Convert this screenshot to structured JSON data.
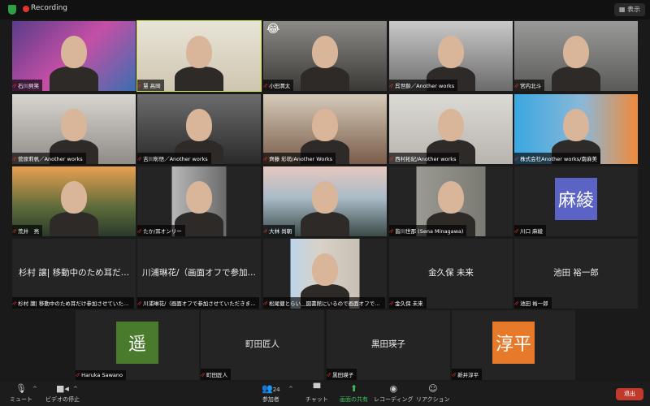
{
  "topbar": {
    "recording_label": "Recording",
    "view_label": "▦ 表示"
  },
  "tiles": [
    {
      "name": "石川貝笑",
      "type": "video",
      "bg": "linear-gradient(135deg,#5b3c8a,#c44fa6 50%,#3a6fb0)"
    },
    {
      "name": "慧 高岡",
      "type": "video",
      "bg": "linear-gradient(180deg,#e8e4d8,#cfc6b0)",
      "active": true
    },
    {
      "name": "小田潤太",
      "type": "video",
      "bg": "linear-gradient(180deg,#8b8a86,#3a3936)",
      "emoji": "😂"
    },
    {
      "name": "呉世齢／Another works",
      "type": "video",
      "bg": "linear-gradient(180deg,#c9c9c9,#6b6b6b)"
    },
    {
      "name": "宮内北斗",
      "type": "video",
      "bg": "linear-gradient(180deg,#9a9a98,#5a5a58)"
    },
    {
      "name": "菅原莉帆／Another works",
      "type": "video",
      "bg": "linear-gradient(180deg,#d9d6d2,#8f8c88)"
    },
    {
      "name": "吉川彰悟／Another works",
      "type": "video",
      "bg": "linear-gradient(180deg,#6c6c6c,#2a2a2a)"
    },
    {
      "name": "齊藤 彩萌/Another Works",
      "type": "video",
      "bg": "linear-gradient(180deg,#d6cbb9,#7a5c4a)"
    },
    {
      "name": "西村拓紀/Another works",
      "type": "video",
      "bg": "linear-gradient(180deg,#dcdad6,#b8b4ae)"
    },
    {
      "name": "株式会社Another works/南麻美",
      "type": "video",
      "bg": "linear-gradient(90deg,#3aa7e0,#8bb8d8 55%,#f08a3a)"
    },
    {
      "name": "荒井　亮",
      "type": "video",
      "bg": "linear-gradient(180deg,#e8a050,#5a6a3a 60%,#2a3a2a)"
    },
    {
      "name": "たか/耳オンリー",
      "type": "video",
      "bg": "linear-gradient(90deg,#242424 28%,#b8b8b8 28%,#6a6a6a 72%,#242424 72%)"
    },
    {
      "name": "大林 尚朝",
      "type": "video",
      "bg": "linear-gradient(180deg,#e6c8c0,#aabbc8 45%,#3a4a48)"
    },
    {
      "name": "皆川世那 (Sena Minagawa)",
      "type": "video",
      "bg": "linear-gradient(90deg,#242424 22%,#9a9a92 22%,#7a7a72 78%,#242424 78%)"
    },
    {
      "name": "川口 麻綾",
      "type": "avatar",
      "avatar_text": "麻綾",
      "avatar_color": "#5b63c4"
    },
    {
      "name": "杉村 譲| 移動中のため耳だけ参加させていただ…",
      "type": "text",
      "center_text": "杉村 譲| 移動中のため耳だ…"
    },
    {
      "name": "川浦琳花/（画面オフで参加させていただきます）",
      "type": "text",
      "center_text": "川浦琳花/（画面オフで参加…"
    },
    {
      "name": "松尾健とらい＿図書館にいるので画面オフで電…",
      "type": "video",
      "bg": "linear-gradient(90deg,#242424 22%,#bcd4ea 22%,#d8d2c8 45%,#c8c0b4 78%,#242424 78%)"
    },
    {
      "name": "金久保 未来",
      "type": "text",
      "center_text": "金久保 未来"
    },
    {
      "name": "池田 裕一郎",
      "type": "text",
      "center_text": "池田 裕一郎"
    },
    {
      "name": "Haruka Sawano",
      "type": "avatar",
      "avatar_text": "遥",
      "avatar_color": "#4a7a2c"
    },
    {
      "name": "町田匠人",
      "type": "text",
      "center_text": "町田匠人"
    },
    {
      "name": "黒田瑛子",
      "type": "text",
      "center_text": "黒田瑛子"
    },
    {
      "name": "新井淳平",
      "type": "avatar",
      "avatar_text": "淳平",
      "avatar_color": "#e67a2a"
    }
  ],
  "toolbar": {
    "mute": "ミュート",
    "video": "ビデオの停止",
    "participants": "参加者",
    "participants_count": "24",
    "chat": "チャット",
    "share": "画面の共有",
    "record": "レコーディング",
    "reactions": "リアクション",
    "leave": "退出"
  },
  "colors": {
    "active_speaker": "#d7e64a",
    "leave": "#c0392b",
    "share": "#3fbf5f",
    "recording": "#e0342f"
  }
}
